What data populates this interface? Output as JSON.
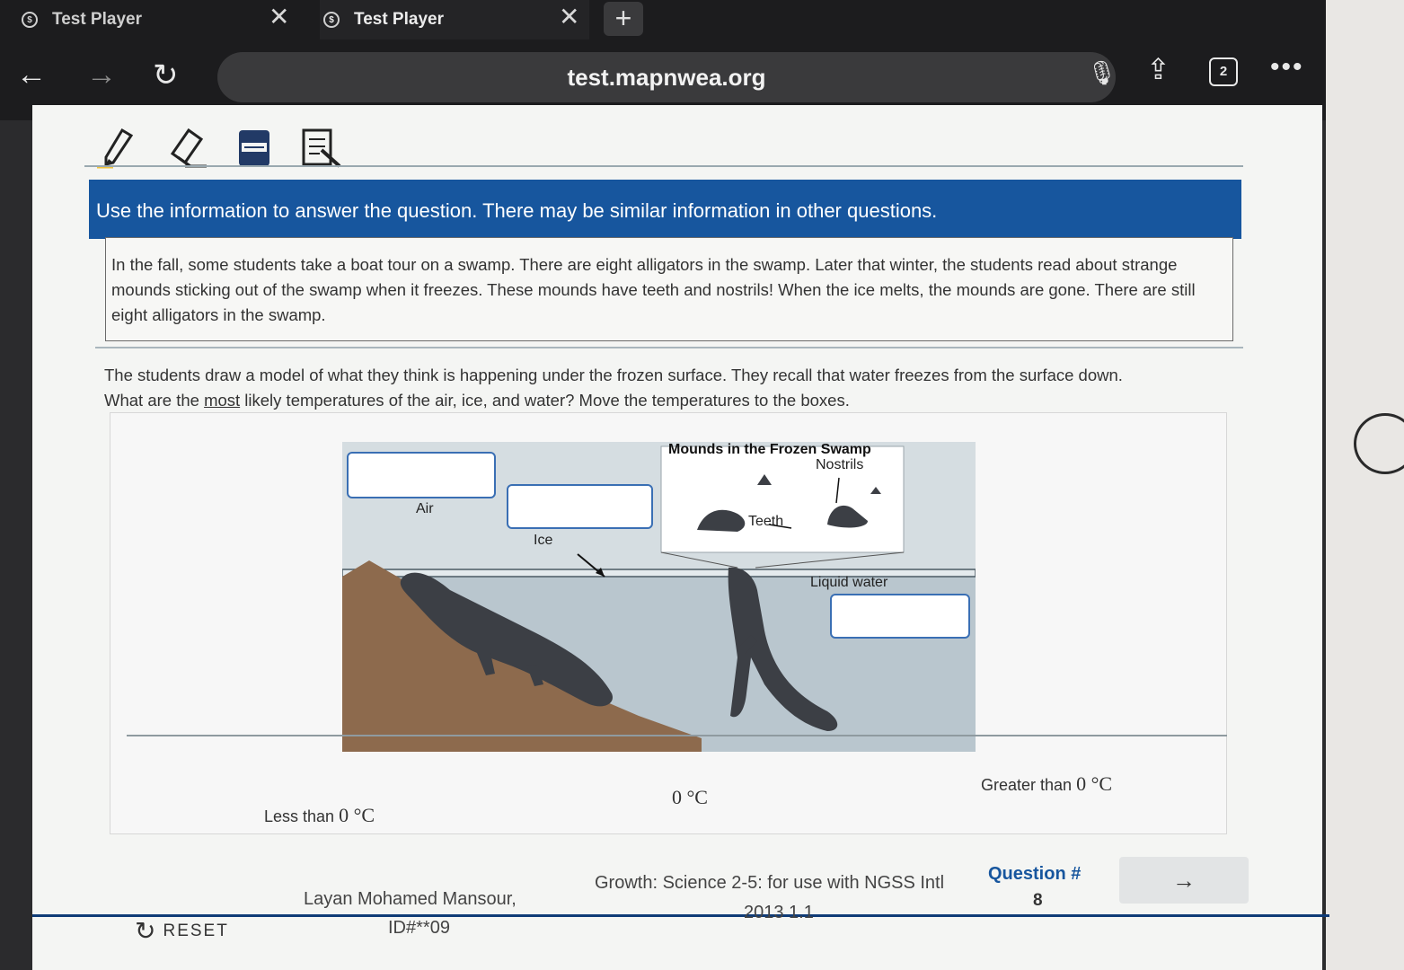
{
  "browser": {
    "tabs": [
      {
        "title": "Test Player",
        "active": false
      },
      {
        "title": "Test Player",
        "active": true
      }
    ],
    "new_tab_symbol": "+",
    "url": "test.mapnwea.org",
    "tab_count": "2",
    "icons": {
      "back": "arrow-left-icon",
      "forward": "arrow-right-icon",
      "reload": "reload-icon",
      "mic": "microphone-icon",
      "share": "share-icon",
      "tabs": "tab-switcher-icon",
      "more": "more-icon",
      "tab_close": "close-icon"
    }
  },
  "tools": [
    "highlighter-icon",
    "eraser-icon",
    "line-reader-icon",
    "answer-masking-icon"
  ],
  "banner": "Use the information to answer the question. There may be similar information in other questions.",
  "passage": "In the fall, some students take a boat tour on a swamp. There are eight alligators in the swamp. Later that winter, the students read about strange mounds sticking out of the swamp when it freezes. These mounds have teeth and nostrils! When the ice melts, the mounds are gone. There are still eight alligators in the swamp.",
  "question": {
    "line1": "The students draw a model of what they think is happening under the frozen surface.  They recall that water freezes from the surface down.",
    "line2_pre": "What are the ",
    "line2_emph": "most",
    "line2_post": " likely temperatures of the air, ice, and water?  Move the temperatures to the boxes."
  },
  "diagram": {
    "inset_title": "Mounds in the Frozen Swamp",
    "labels": {
      "nostrils": "Nostrils",
      "teeth": "Teeth",
      "air": "Air",
      "ice": "Ice",
      "liquid_water": "Liquid water"
    },
    "colors": {
      "sky": "#d5dde1",
      "water": "#b9c6ce",
      "mud": "#8d6a4d",
      "alligator": "#3c3f45",
      "box_border": "#3a6fb4"
    }
  },
  "options": [
    {
      "prefix": "Less than ",
      "value": "0 °C"
    },
    {
      "prefix": "",
      "value": "0 °C"
    },
    {
      "prefix": "Greater than ",
      "value": "0 °C"
    }
  ],
  "footer": {
    "reset": "RESET",
    "student_name": "Layan Mohamed Mansour,",
    "student_id": "ID#**09",
    "test_line1": "Growth: Science 2-5: for use with NGSS Intl",
    "test_line2": "2013 1.1",
    "question_label": "Question #",
    "question_number": "8",
    "next_symbol": "→"
  }
}
